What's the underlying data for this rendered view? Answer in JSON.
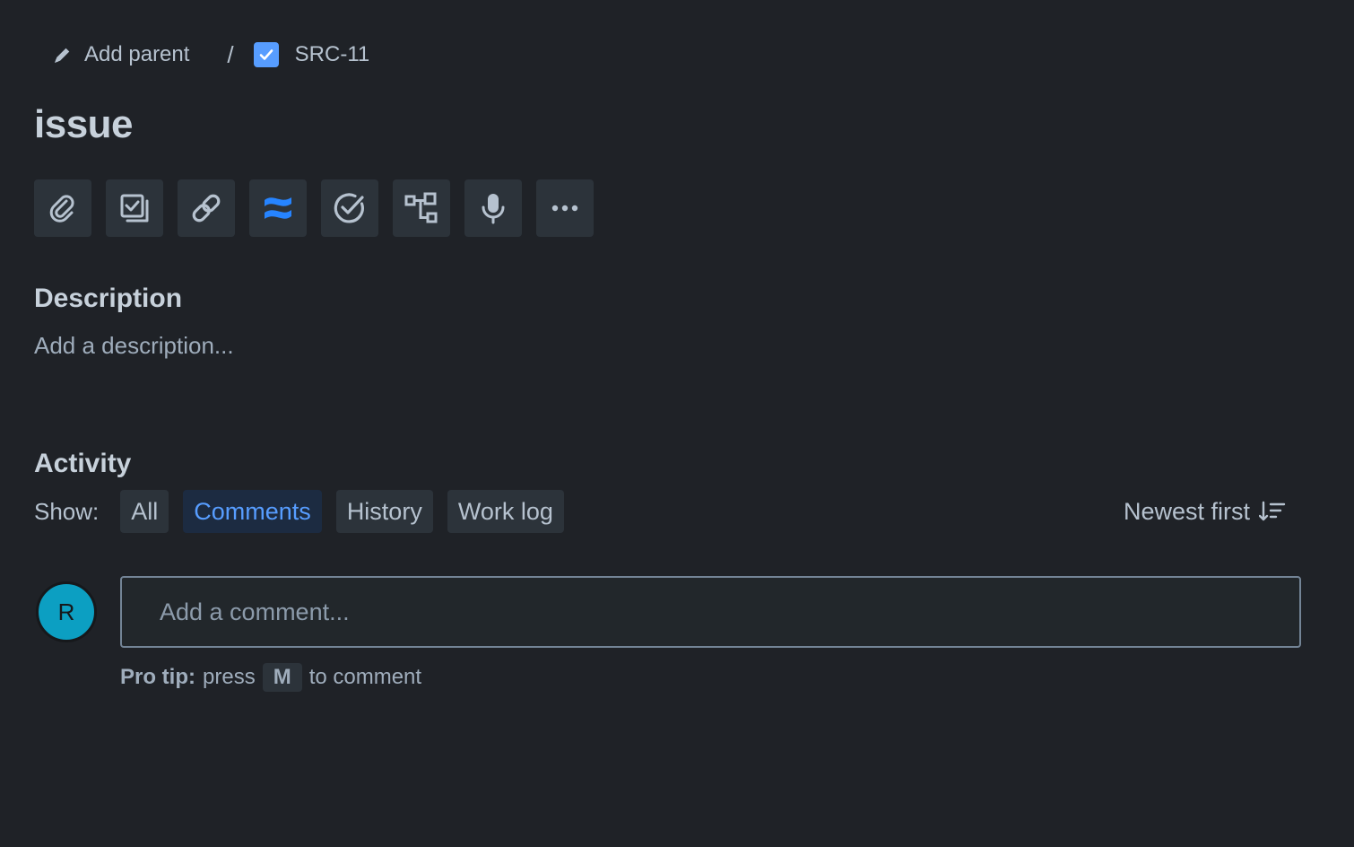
{
  "breadcrumb": {
    "parent_label": "Add parent",
    "separator": "/",
    "issue_key": "SRC-11"
  },
  "issue": {
    "title": "issue"
  },
  "toolbar": {
    "items": [
      {
        "icon": "paperclip-icon",
        "label": "Attach"
      },
      {
        "icon": "subtask-icon",
        "label": "Add a child issue"
      },
      {
        "icon": "link-icon",
        "label": "Link issue"
      },
      {
        "icon": "confluence-icon",
        "label": "Confluence"
      },
      {
        "icon": "checkmark-circle-icon",
        "label": "Checklist"
      },
      {
        "icon": "hierarchy-icon",
        "label": "Hierarchy"
      },
      {
        "icon": "microphone-icon",
        "label": "Record"
      },
      {
        "icon": "more-icon",
        "label": "More"
      }
    ]
  },
  "description": {
    "heading": "Description",
    "placeholder": "Add a description..."
  },
  "activity": {
    "heading": "Activity",
    "show_label": "Show:",
    "filters": [
      {
        "label": "All",
        "active": false
      },
      {
        "label": "Comments",
        "active": true
      },
      {
        "label": "History",
        "active": false
      },
      {
        "label": "Work log",
        "active": false
      }
    ],
    "sort_label": "Newest first"
  },
  "comment": {
    "avatar_initial": "R",
    "placeholder": "Add a comment...",
    "pro_tip_label": "Pro tip:",
    "pro_tip_press": "press",
    "pro_tip_key": "M",
    "pro_tip_suffix": "to comment"
  },
  "colors": {
    "background": "#1f2227",
    "accent": "#579dff",
    "avatar": "#0c9fc2"
  }
}
